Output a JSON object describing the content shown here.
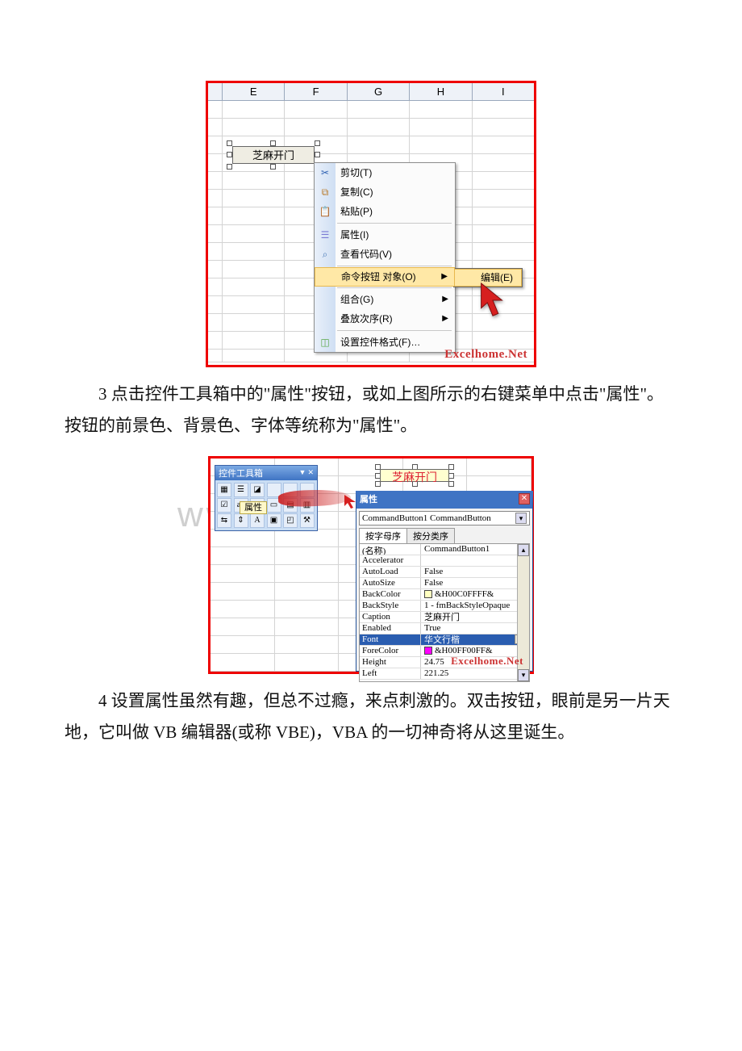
{
  "screenshot1": {
    "columns": [
      "E",
      "F",
      "G",
      "H",
      "I"
    ],
    "button_label": "芝麻开门",
    "context_menu": {
      "cut": "剪切(T)",
      "copy": "复制(C)",
      "paste": "粘贴(P)",
      "properties": "属性(I)",
      "view_code": "查看代码(V)",
      "cmd_button_object": "命令按钮 对象(O)",
      "grouping": "组合(G)",
      "order": "叠放次序(R)",
      "format_control": "设置控件格式(F)…"
    },
    "submenu": {
      "edit": "编辑(E)"
    },
    "watermark": "Excelhome.Net"
  },
  "paragraph1": "3 点击控件工具箱中的\"属性\"按钮，或如上图所示的右键菜单中点击\"属性\"。按钮的前景色、背景色、字体等统称为\"属性\"。",
  "screenshot2": {
    "toolbox_title": "控件工具箱",
    "attr_button": "属性",
    "designed_button": "芝麻开门",
    "props_title": "属性",
    "props_combo": "CommandButton1 CommandButton",
    "tab_alpha": "按字母序",
    "tab_category": "按分类序",
    "rows": [
      {
        "name": "(名称)",
        "value": "CommandButton1"
      },
      {
        "name": "Accelerator",
        "value": ""
      },
      {
        "name": "AutoLoad",
        "value": "False"
      },
      {
        "name": "AutoSize",
        "value": "False"
      },
      {
        "name": "BackColor",
        "value": "&H00C0FFFF&",
        "swatch": "#ffffc0"
      },
      {
        "name": "BackStyle",
        "value": "1 - fmBackStyleOpaque"
      },
      {
        "name": "Caption",
        "value": "芝麻开门"
      },
      {
        "name": "Enabled",
        "value": "True"
      },
      {
        "name": "Font",
        "value": "华文行楷",
        "selected": true,
        "ellipsis": true
      },
      {
        "name": "ForeColor",
        "value": "&H00FF00FF&",
        "swatch": "#ff00ff"
      },
      {
        "name": "Height",
        "value": "24.75"
      },
      {
        "name": "Left",
        "value": "221.25"
      }
    ],
    "watermark": "Excelhome.Net"
  },
  "paragraph2": "4 设置属性虽然有趣，但总不过瘾，来点刺激的。双击按钮，眼前是另一片天地，它叫做 VB 编辑器(或称 VBE)，VBA 的一切神奇将从这里诞生。",
  "doc_watermark": "www.bdocx.com"
}
